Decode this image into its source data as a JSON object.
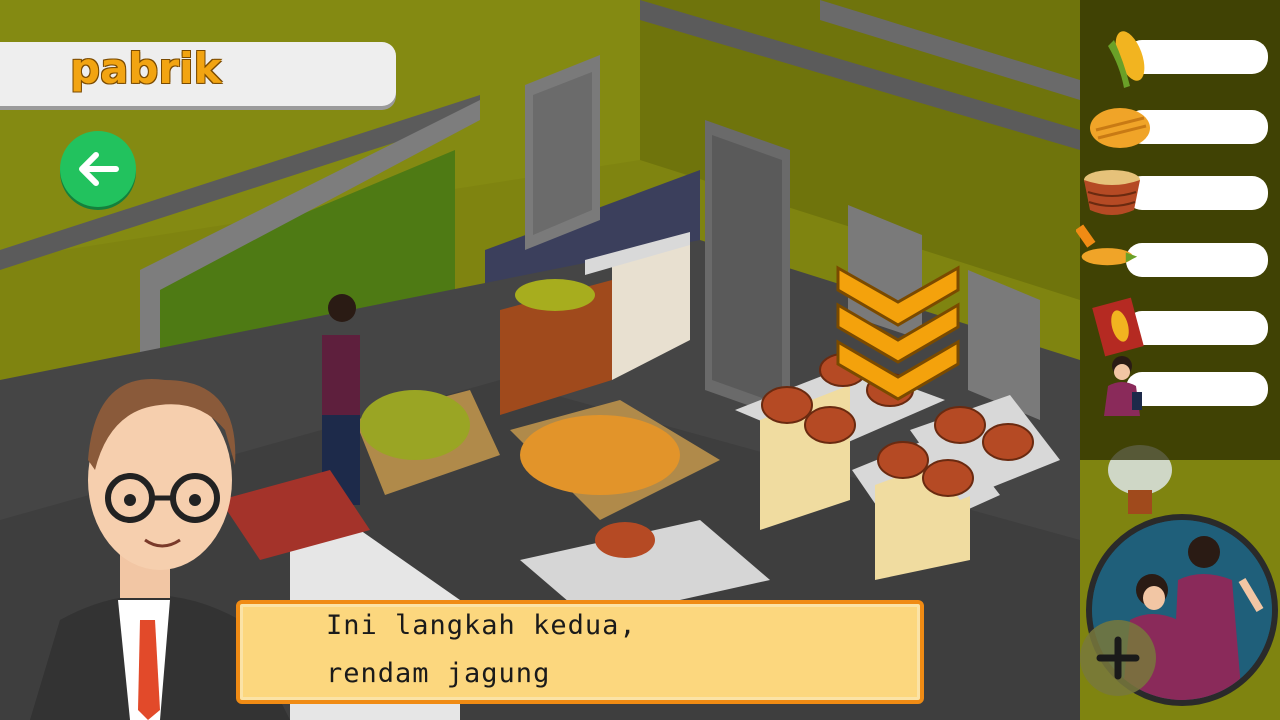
{
  "header": {
    "title": "pabrik"
  },
  "dialog": {
    "line1": "Ini langkah kedua,",
    "line2": "rendam jagung"
  },
  "inventory": {
    "items": [
      {
        "icon": "corn-cob-icon",
        "value": ""
      },
      {
        "icon": "corn-kernels-icon",
        "value": ""
      },
      {
        "icon": "soaking-basket-icon",
        "value": ""
      },
      {
        "icon": "cut-corn-icon",
        "value": ""
      },
      {
        "icon": "corn-snack-pack-icon",
        "value": ""
      },
      {
        "icon": "worker-icon",
        "value": ""
      }
    ]
  },
  "colors": {
    "accent": "#f2a412",
    "back_button": "#22c25e",
    "dialog_bg": "#fcd77e",
    "dialog_border": "#f08b14"
  }
}
